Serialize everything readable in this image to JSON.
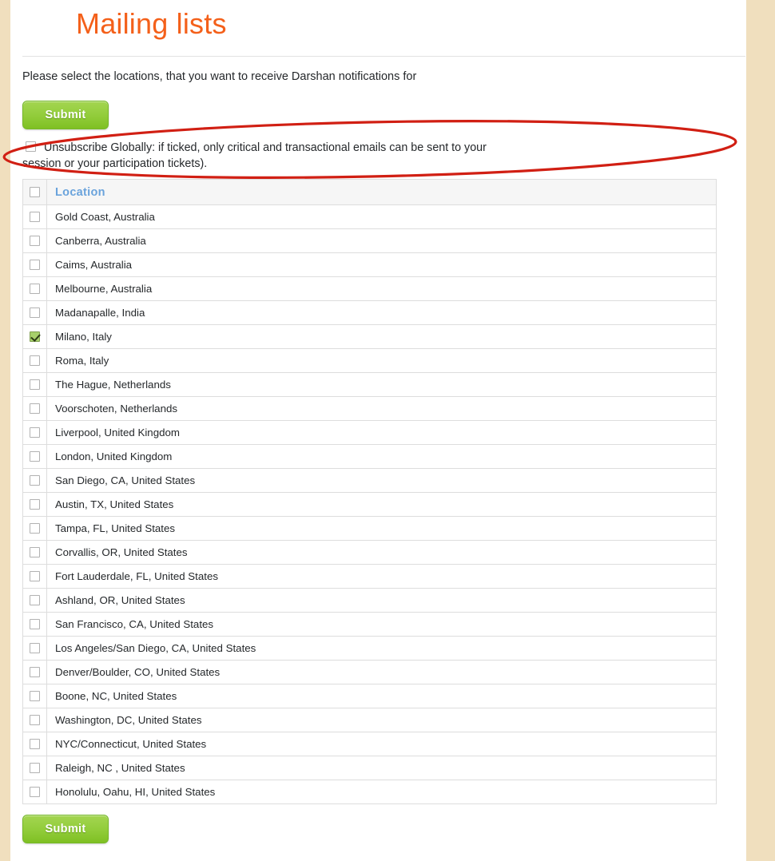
{
  "page": {
    "title": "Mailing lists",
    "intro": "Please select the locations, that you want to receive Darshan notifications for",
    "title_color": "#f4601a",
    "background_color": "#f0dfbe",
    "sheet_color": "#ffffff"
  },
  "buttons": {
    "submit_top_label": "Submit",
    "submit_bottom_label": "Submit",
    "submit_color": "#8fc93a"
  },
  "unsubscribe": {
    "line1": "Unsubscribe Globally: if ticked, only critical and transactional emails can be sent to your",
    "line2": "session or your participation tickets).",
    "checked": false
  },
  "annotation": {
    "shape": "ellipse",
    "color": "#d11f13"
  },
  "table": {
    "header_label": "Location",
    "header_checkbox_checked": false,
    "rows": [
      {
        "label": "Gold Coast, Australia",
        "checked": false
      },
      {
        "label": "Canberra, Australia",
        "checked": false
      },
      {
        "label": "Caims, Australia",
        "checked": false
      },
      {
        "label": "Melbourne, Australia",
        "checked": false
      },
      {
        "label": "Madanapalle, India",
        "checked": false
      },
      {
        "label": "Milano, Italy",
        "checked": true
      },
      {
        "label": "Roma, Italy",
        "checked": false
      },
      {
        "label": "The Hague, Netherlands",
        "checked": false
      },
      {
        "label": "Voorschoten, Netherlands",
        "checked": false
      },
      {
        "label": "Liverpool, United Kingdom",
        "checked": false
      },
      {
        "label": "London, United Kingdom",
        "checked": false
      },
      {
        "label": "San Diego, CA, United States",
        "checked": false
      },
      {
        "label": "Austin, TX, United States",
        "checked": false
      },
      {
        "label": "Tampa, FL, United States",
        "checked": false
      },
      {
        "label": "Corvallis, OR, United States",
        "checked": false
      },
      {
        "label": "Fort Lauderdale, FL, United States",
        "checked": false
      },
      {
        "label": "Ashland, OR, United States",
        "checked": false
      },
      {
        "label": "San Francisco, CA, United States",
        "checked": false
      },
      {
        "label": "Los Angeles/San Diego, CA, United States",
        "checked": false
      },
      {
        "label": "Denver/Boulder, CO, United States",
        "checked": false
      },
      {
        "label": "Boone, NC, United States",
        "checked": false
      },
      {
        "label": "Washington, DC, United States",
        "checked": false
      },
      {
        "label": "NYC/Connecticut, United States",
        "checked": false
      },
      {
        "label": "Raleigh, NC , United States",
        "checked": false
      },
      {
        "label": "Honolulu, Oahu, HI, United States",
        "checked": false
      }
    ]
  }
}
